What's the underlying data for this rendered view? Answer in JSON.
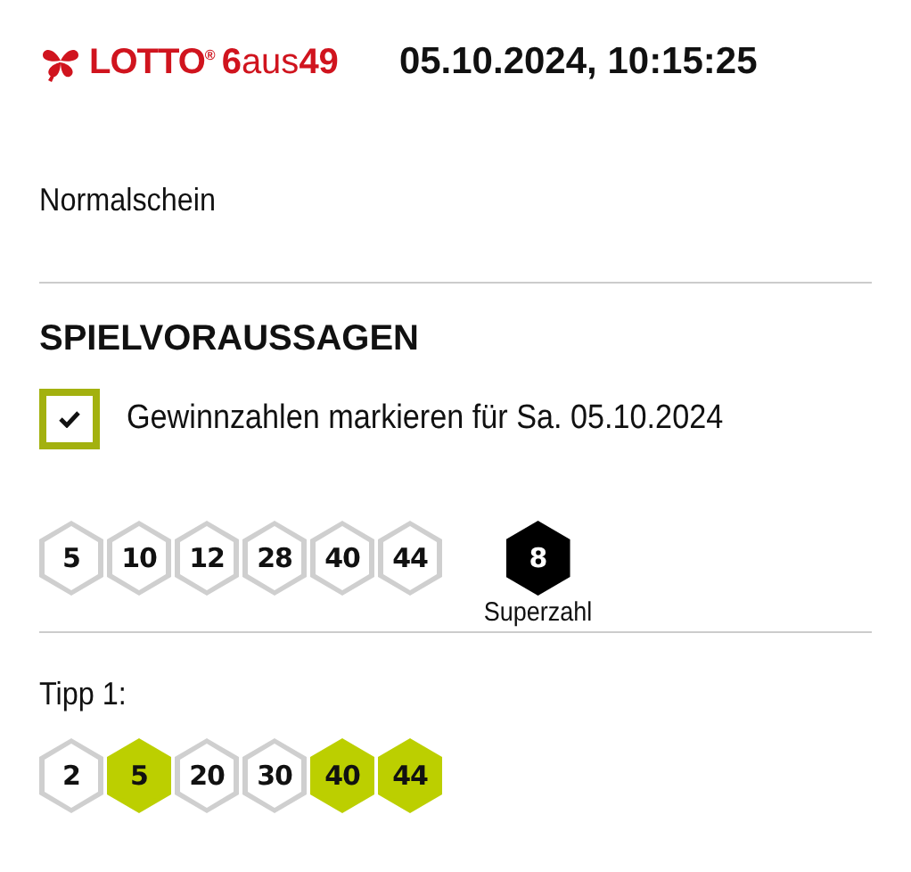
{
  "header": {
    "logo_brand": "LOTTO$^{®}$",
    "logo_game": "**6**aus**49**",
    "datetime": "05.10.2024, 10:15:25"
  },
  "ticket_type": "Normalschein",
  "section_title": "SPIELVORAUSSAGEN",
  "mark_winning": {
    "label": "Gewinnzahlen markieren für Sa. 05.10.2024",
    "checked": true
  },
  "draw": {
    "numbers": [
      "5",
      "10",
      "12",
      "28",
      "40",
      "44"
    ],
    "superzahl": "8",
    "superzahl_label": "Superzahl"
  },
  "tips": [
    {
      "label": "Tipp 1:",
      "numbers": [
        {
          "value": "2",
          "matched": false
        },
        {
          "value": "5",
          "matched": true
        },
        {
          "value": "20",
          "matched": false
        },
        {
          "value": "30",
          "matched": false
        },
        {
          "value": "40",
          "matched": true
        },
        {
          "value": "44",
          "matched": true
        }
      ]
    }
  ]
}
